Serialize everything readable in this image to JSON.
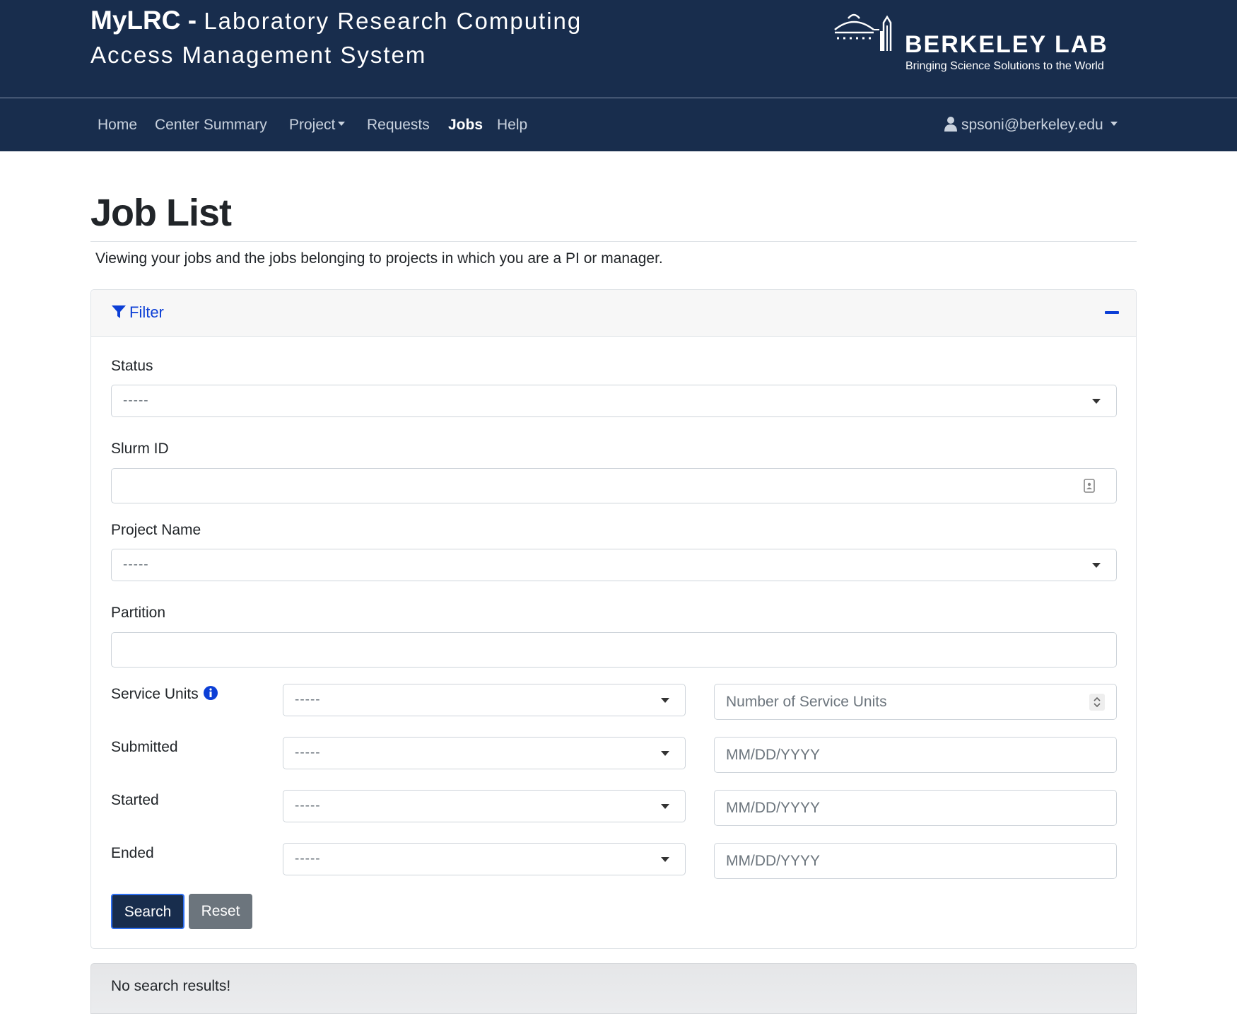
{
  "header": {
    "app_name": "MyLRC -",
    "app_subtitle_1": "Laboratory Research Computing",
    "app_subtitle_2": "Access Management System",
    "logo_name": "BERKELEY LAB",
    "logo_tagline": "Bringing Science Solutions to the World"
  },
  "nav": {
    "items": [
      {
        "label": "Home"
      },
      {
        "label": "Center Summary"
      },
      {
        "label": "Project"
      },
      {
        "label": "Requests"
      },
      {
        "label": "Jobs",
        "active": true
      },
      {
        "label": "Help"
      }
    ],
    "user": "spsoni@berkeley.edu"
  },
  "page": {
    "title": "Job List",
    "subtitle": "Viewing your jobs and the jobs belonging to projects in which you are a PI or manager."
  },
  "filter": {
    "header_label": "Filter",
    "status": {
      "label": "Status",
      "value": "-----"
    },
    "slurm_id": {
      "label": "Slurm ID",
      "value": ""
    },
    "project_name": {
      "label": "Project Name",
      "value": "-----"
    },
    "partition": {
      "label": "Partition",
      "value": ""
    },
    "service_units": {
      "label": "Service Units",
      "operator": "-----",
      "placeholder": "Number of Service Units"
    },
    "submitted": {
      "label": "Submitted",
      "operator": "-----",
      "placeholder": "MM/DD/YYYY"
    },
    "started": {
      "label": "Started",
      "operator": "-----",
      "placeholder": "MM/DD/YYYY"
    },
    "ended": {
      "label": "Ended",
      "operator": "-----",
      "placeholder": "MM/DD/YYYY"
    },
    "search_label": "Search",
    "reset_label": "Reset"
  },
  "results": {
    "message": "No search results!"
  },
  "colors": {
    "navy": "#182d4d",
    "link_blue": "#0c3fd6",
    "search_border": "#2e6ff0",
    "reset_gray": "#6c757d"
  }
}
